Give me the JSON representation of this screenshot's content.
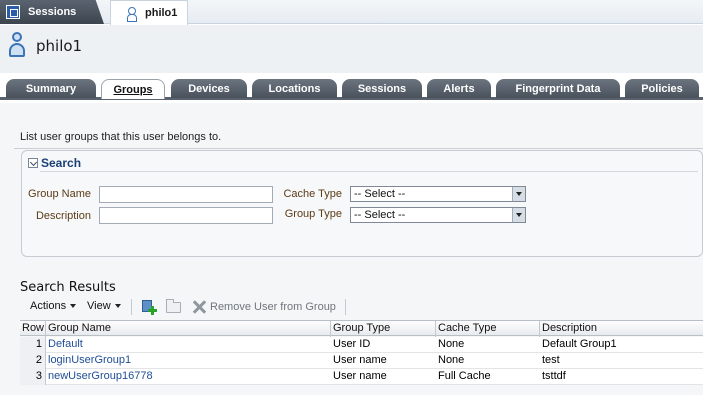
{
  "doc_tabs": [
    {
      "label": "Sessions"
    },
    {
      "label": "philo1"
    }
  ],
  "header": {
    "title": "philo1"
  },
  "subtabs": [
    "Summary",
    "Groups",
    "Devices",
    "Locations",
    "Sessions",
    "Alerts",
    "Fingerprint Data",
    "Policies"
  ],
  "active_subtab": "Groups",
  "description": "List user groups that this user belongs to.",
  "search": {
    "title": "Search",
    "group_name_label": "Group Name",
    "group_name_value": "",
    "description_label": "Description",
    "description_value": "",
    "cache_type_label": "Cache Type",
    "cache_type_value": "-- Select --",
    "group_type_label": "Group Type",
    "group_type_value": "-- Select --"
  },
  "results": {
    "title": "Search Results",
    "toolbar": {
      "actions_label": "Actions",
      "view_label": "View",
      "remove_label": "Remove User from Group"
    },
    "columns": [
      "Row",
      "Group Name",
      "Group Type",
      "Cache Type",
      "Description"
    ],
    "rows": [
      {
        "row": "1",
        "group_name": "Default",
        "group_type": "User ID",
        "cache_type": "None",
        "description": "Default Group1"
      },
      {
        "row": "2",
        "group_name": "loginUserGroup1",
        "group_type": "User name",
        "cache_type": "None",
        "description": "test"
      },
      {
        "row": "3",
        "group_name": "newUserGroup16778",
        "group_type": "User name",
        "cache_type": "Full Cache",
        "description": "tsttdf"
      }
    ]
  },
  "colors": {
    "tab_dark": "#49525c",
    "link": "#1f4e96",
    "label_brown": "#5b3b16",
    "search_title": "#1b3f75"
  }
}
